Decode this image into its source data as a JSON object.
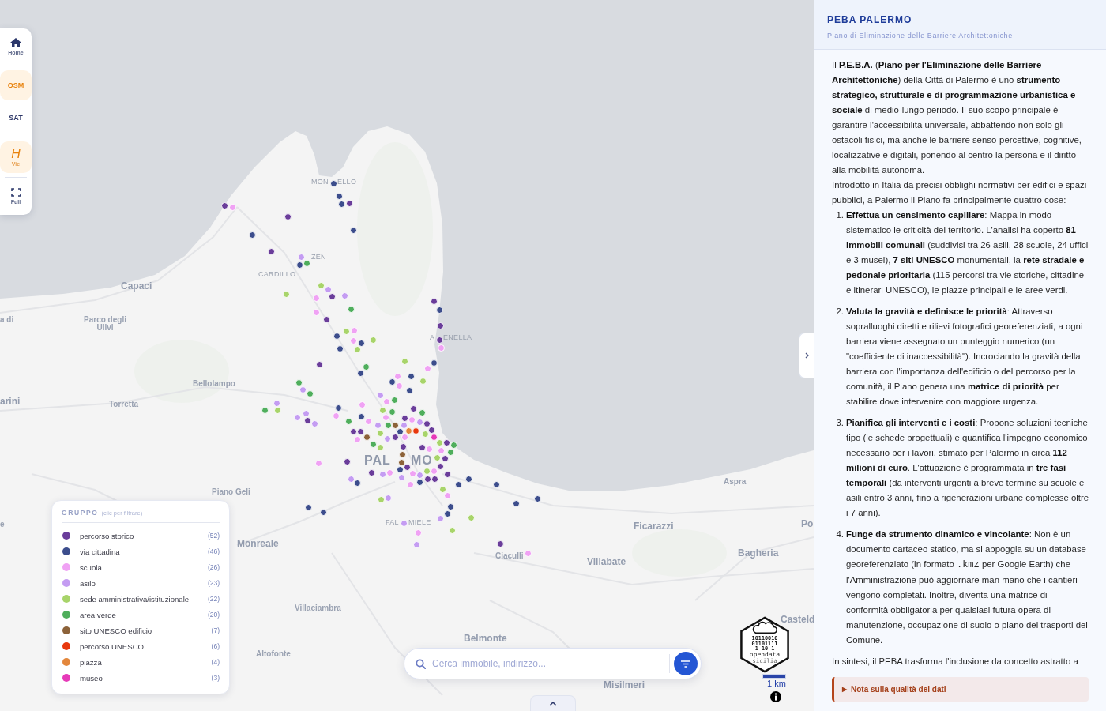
{
  "toolbar": {
    "home": {
      "label": "Home"
    },
    "base_layers": [
      {
        "label": "OSM",
        "selected": true
      },
      {
        "label": "SAT",
        "selected": false
      }
    ],
    "roads_toggle": {
      "glyph": "H",
      "label": "Vie",
      "on": true
    },
    "fullscreen": {
      "label": "Full"
    }
  },
  "map": {
    "labels": [
      {
        "text": "MON",
        "kind": "district"
      },
      {
        "text": "ELLO",
        "kind": "district"
      },
      {
        "text": "ZEN",
        "kind": "district"
      },
      {
        "text": "CARDILLO",
        "kind": "district"
      },
      {
        "text": "Capaci",
        "kind": "town"
      },
      {
        "text": "a di",
        "kind": "village"
      },
      {
        "text": "Parco degli Ulivi",
        "kind": "area"
      },
      {
        "text": "A",
        "kind": "district"
      },
      {
        "text": "ENELLA",
        "kind": "district"
      },
      {
        "text": "Bellolampo",
        "kind": "village"
      },
      {
        "text": "arini",
        "kind": "town"
      },
      {
        "text": "Torretta",
        "kind": "village"
      },
      {
        "text": "PAL",
        "kind": "city"
      },
      {
        "text": "MO",
        "kind": "city"
      },
      {
        "text": "Aspra",
        "kind": "village"
      },
      {
        "text": "Piano Geli",
        "kind": "village"
      },
      {
        "text": "e",
        "kind": "village"
      },
      {
        "text": "FAL",
        "kind": "district"
      },
      {
        "text": "MIELE",
        "kind": "district"
      },
      {
        "text": "Ficarazzi",
        "kind": "town"
      },
      {
        "text": "Po",
        "kind": "town"
      },
      {
        "text": "Monreale",
        "kind": "town"
      },
      {
        "text": "Bagheria",
        "kind": "town"
      },
      {
        "text": "Ciaculli",
        "kind": "village"
      },
      {
        "text": "Villabate",
        "kind": "town"
      },
      {
        "text": "Villaciambra",
        "kind": "village"
      },
      {
        "text": "Casteld",
        "kind": "town"
      },
      {
        "text": "Belmonte",
        "kind": "town"
      },
      {
        "text": "Altofonte",
        "kind": "village"
      },
      {
        "text": "Misilmeri",
        "kind": "town"
      }
    ]
  },
  "legend": {
    "title": "GRUPPO",
    "hint": "(clic per filtrare)",
    "items": [
      {
        "label": "percorso storico",
        "count": "(52)",
        "color": "#6a3d9a"
      },
      {
        "label": "via cittadina",
        "count": "(46)",
        "color": "#3c4d8c"
      },
      {
        "label": "scuola",
        "count": "(26)",
        "color": "#f0a2f4"
      },
      {
        "label": "asilo",
        "count": "(23)",
        "color": "#c49cf2"
      },
      {
        "label": "sede amministrativa/istituzionale",
        "count": "(22)",
        "color": "#a8d46a"
      },
      {
        "label": "area verde",
        "count": "(20)",
        "color": "#4fae5c"
      },
      {
        "label": "sito UNESCO edificio",
        "count": "(7)",
        "color": "#8c6239"
      },
      {
        "label": "percorso UNESCO",
        "count": "(6)",
        "color": "#e8380d"
      },
      {
        "label": "piazza",
        "count": "(4)",
        "color": "#e3873c"
      },
      {
        "label": "museo",
        "count": "(3)",
        "color": "#e63ab8"
      }
    ]
  },
  "search": {
    "placeholder": "Cerca immobile, indirizzo..."
  },
  "logo": {
    "binary": [
      "10110010",
      "01101111",
      "1 10 1"
    ],
    "name": "opendata",
    "region": "sicilia"
  },
  "scale": {
    "label": "1 km"
  },
  "panel": {
    "title": "PEBA PALERMO",
    "subtitle": "Piano di Eliminazione delle Barriere Architettoniche",
    "intro": [
      "Il **P.E.B.A.** (**Piano per l'Eliminazione delle Barriere Architettoniche**) della Città di Palermo è uno **strumento strategico, strutturale e di programmazione urbanistica e sociale** di medio-lungo periodo. Il suo scopo principale è garantire l'accessibilità universale, abbattendo non solo gli ostacoli fisici, ma anche le barriere senso-percettive, cognitive, localizzative e digitali, ponendo al centro la persona e il diritto alla mobilità autonoma.",
      "Introdotto in Italia da precisi obblighi normativi per edifici e spazi pubblici, a Palermo il Piano fa principalmente quattro cose:"
    ],
    "steps": [
      {
        "number": "1.",
        "parts": [
          {
            "kind": "text",
            "text": "**Effettua un censimento capillare**: Mappa in modo sistematico le criticità del territorio. L'analisi ha coperto **81 immobili comunali** (suddivisi tra 26 asili, 28 scuole, 24 uffici e 3 musei), **7 siti UNESCO** monumentali, la **rete stradale e pedonale prioritaria** (115 percorsi tra vie storiche, cittadine e itinerari UNESCO), le piazze principali e le aree verdi."
          }
        ]
      },
      {
        "number": "2.",
        "parts": [
          {
            "kind": "text",
            "text": "**Valuta la gravità e definisce le priorità**: Attraverso sopralluoghi diretti e rilievi fotografici georeferenziati, a ogni barriera viene assegnato un punteggio numerico (un \"coefficiente di inaccessibilità\"). Incrociando la gravità della barriera con l'importanza dell'edificio o del percorso per la comunità, il Piano genera una **matrice di priorità** per stabilire dove intervenire con maggiore urgenza."
          }
        ]
      },
      {
        "number": "3.",
        "parts": [
          {
            "kind": "text",
            "text": "**Pianifica gli interventi e i costi**: Propone soluzioni tecniche tipo (le schede progettuali) e quantifica l'impegno economico necessario per i lavori, stimato per Palermo in circa **112 milioni di euro**. L'attuazione è programmata in **tre fasi temporali** (da interventi urgenti a breve termine su scuole e asili entro 3 anni, fino a rigenerazioni urbane complesse oltre i 7 anni)."
          }
        ]
      },
      {
        "number": "4.",
        "parts": [
          {
            "kind": "text",
            "text": "**Funge da strumento dinamico e vincolante**: Non è un documento cartaceo statico, ma si appoggia su un database georeferenziato (in formato "
          },
          {
            "kind": "code",
            "text": ".kmz"
          },
          {
            "kind": "text",
            "text": " per Google Earth) che l'Amministrazione può aggiornare man mano che i cantieri vengono completati. Inoltre, diventa una matrice di conformità obbligatoria per qualsiasi futura opera di manutenzione, occupazione di suolo o piano dei trasporti del Comune."
          }
        ]
      }
    ],
    "closing": "In sintesi, il PEBA trasforma l'inclusione da concetto astratto a",
    "note": {
      "marker": "▶",
      "label": "Nota sulla qualità dei dati",
      "expanded": false
    }
  }
}
